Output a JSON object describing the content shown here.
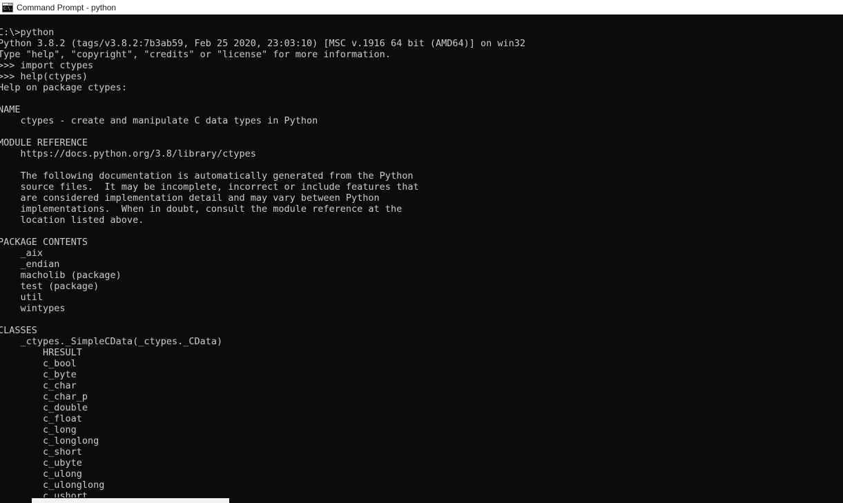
{
  "window": {
    "title": "Command Prompt - python",
    "icon": "console-icon",
    "icon_glyph": "C:\\.",
    "titlebar_bg": "#ffffff",
    "titlebar_fg": "#1a1a1a",
    "console_bg": "#0c0c0c",
    "console_fg": "#cccccc"
  },
  "console": {
    "lines": [
      "C:\\>python",
      "Python 3.8.2 (tags/v3.8.2:7b3ab59, Feb 25 2020, 23:03:10) [MSC v.1916 64 bit (AMD64)] on win32",
      "Type \"help\", \"copyright\", \"credits\" or \"license\" for more information.",
      ">>> import ctypes",
      ">>> help(ctypes)",
      "Help on package ctypes:",
      "",
      "NAME",
      "    ctypes - create and manipulate C data types in Python",
      "",
      "MODULE REFERENCE",
      "    https://docs.python.org/3.8/library/ctypes",
      "",
      "    The following documentation is automatically generated from the Python",
      "    source files.  It may be incomplete, incorrect or include features that",
      "    are considered implementation detail and may vary between Python",
      "    implementations.  When in doubt, consult the module reference at the",
      "    location listed above.",
      "",
      "PACKAGE CONTENTS",
      "    _aix",
      "    _endian",
      "    macholib (package)",
      "    test (package)",
      "    util",
      "    wintypes",
      "",
      "CLASSES",
      "    _ctypes._SimpleCData(_ctypes._CData)",
      "        HRESULT",
      "        c_bool",
      "        c_byte",
      "        c_char",
      "        c_char_p",
      "        c_double",
      "        c_float",
      "        c_long",
      "        c_longlong",
      "        c_short",
      "        c_ubyte",
      "        c_ulong",
      "        c_ulonglong",
      "        c_ushort"
    ]
  },
  "scrollbar": {
    "orientation": "horizontal",
    "thumb_color": "#f2f2f2"
  }
}
